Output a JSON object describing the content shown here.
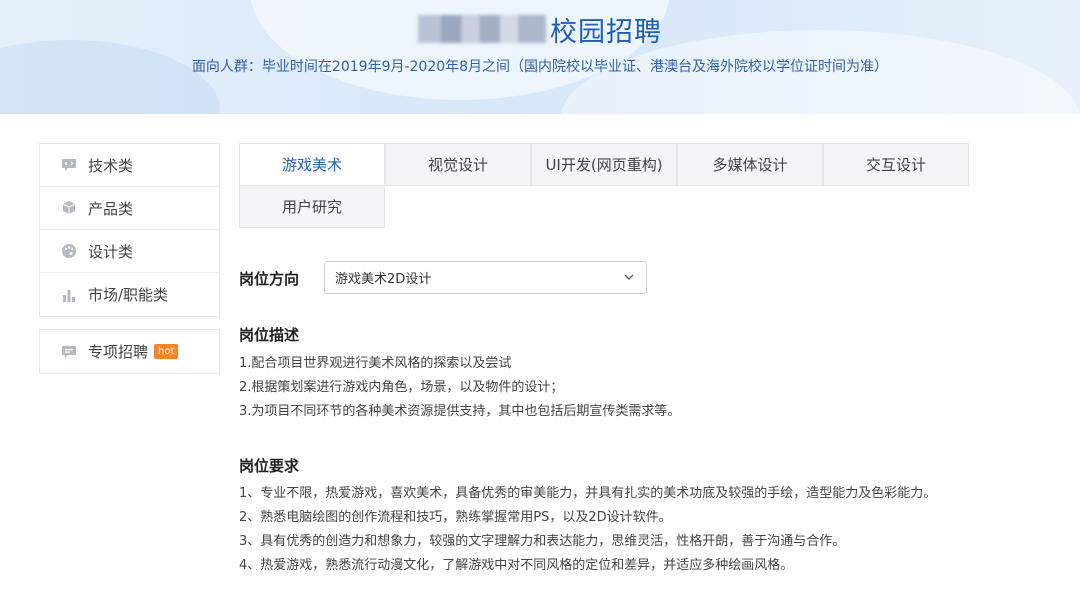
{
  "header": {
    "title": "校园招聘",
    "subtitle": "面向人群：毕业时间在2019年9月-2020年8月之间（国内院校以毕业证、港澳台及海外院校以学位证时间为准）"
  },
  "sidebar": {
    "items": [
      {
        "label": "技术类",
        "icon": "code-chat-icon"
      },
      {
        "label": "产品类",
        "icon": "cube-icon"
      },
      {
        "label": "设计类",
        "icon": "palette-icon"
      },
      {
        "label": "市场/职能类",
        "icon": "bar-chart-icon"
      }
    ],
    "special": {
      "label": "专项招聘",
      "badge": "hot",
      "icon": "message-icon"
    }
  },
  "tabs": [
    "游戏美术",
    "视觉设计",
    "UI开发(网页重构)",
    "多媒体设计",
    "交互设计",
    "用户研究"
  ],
  "active_tab": "游戏美术",
  "direction": {
    "label": "岗位方向",
    "selected": "游戏美术2D设计"
  },
  "description": {
    "heading": "岗位描述",
    "items": [
      "1.配合项目世界观进行美术风格的探索以及尝试",
      "2.根据策划案进行游戏内角色，场景，以及物件的设计；",
      "3.为项目不同环节的各种美术资源提供支持，其中也包括后期宣传类需求等。"
    ]
  },
  "requirements": {
    "heading": "岗位要求",
    "items": [
      "1、专业不限，热爱游戏，喜欢美术，具备优秀的审美能力，并具有扎实的美术功底及较强的手绘，造型能力及色彩能力。",
      "2、熟悉电脑绘图的创作流程和技巧，熟练掌握常用PS，以及2D设计软件。",
      "3、具有优秀的创造力和想象力，较强的文字理解力和表达能力，思维灵活，性格开朗，善于沟通与合作。",
      "4、热爱游戏，熟悉流行动漫文化，了解游戏中对不同风格的定位和差异，并适应多种绘画风格。"
    ]
  },
  "colors": {
    "accent": "#2a63b6",
    "badge": "#f5842b"
  }
}
